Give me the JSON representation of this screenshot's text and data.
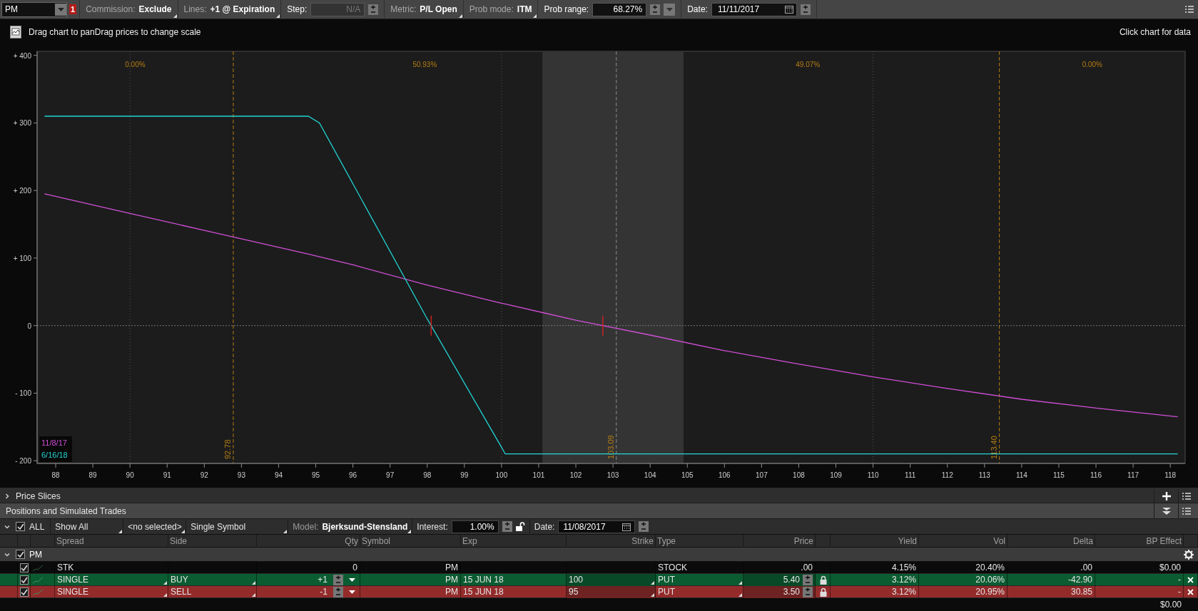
{
  "toolbar": {
    "symbol": "PM",
    "alert_badge": "1",
    "items": [
      {
        "kind": "setting",
        "label": "Commission:",
        "value": "Exclude"
      },
      {
        "kind": "setting",
        "label": "Lines:",
        "value": "+1 @ Expiration"
      },
      {
        "kind": "field",
        "label": "Step:",
        "value": "N/A",
        "disabled": true,
        "dropdown": false
      },
      {
        "kind": "setting",
        "label": "Metric:",
        "value": "P/L Open"
      },
      {
        "kind": "setting",
        "label": "Prob mode:",
        "value": "ITM"
      },
      {
        "kind": "field",
        "label": "Prob range:",
        "value": "68.27%",
        "disabled": false,
        "dropdown": true
      },
      {
        "kind": "date",
        "label": "Date:",
        "value": "11/11/2017"
      }
    ]
  },
  "chart_header": {
    "hint": "Drag chart to panDrag prices to change scale",
    "right_hint": "Click chart for data"
  },
  "chart": {
    "chart_data": {
      "type": "line",
      "x": [
        87.7,
        90,
        92,
        94,
        94.8,
        95.1,
        96,
        98,
        100,
        100.1,
        102,
        104,
        106,
        108,
        110,
        112,
        114,
        116,
        118.2
      ],
      "series": [
        {
          "name": "11/8/17",
          "color": "#d24fd8",
          "values": [
            195,
            166,
            141,
            116,
            106,
            102,
            90,
            60,
            33,
            32,
            8,
            -14,
            -37,
            -57,
            -76,
            -93,
            -109,
            -122,
            -135
          ]
        },
        {
          "name": "6/16/18",
          "color": "#22d4d4",
          "values": [
            310,
            310,
            310,
            310,
            310,
            300,
            210,
            10,
            -180,
            -190,
            -190,
            -190,
            -190,
            -190,
            -190,
            -190,
            -190,
            -190,
            -190
          ]
        }
      ],
      "xlim": [
        87.5,
        118.4
      ],
      "ylim": [
        -204,
        406
      ],
      "xticks": [
        88,
        89,
        90,
        91,
        92,
        93,
        94,
        95,
        96,
        97,
        98,
        99,
        100,
        101,
        102,
        103,
        104,
        105,
        106,
        107,
        108,
        109,
        110,
        111,
        112,
        113,
        114,
        115,
        116,
        117,
        118
      ],
      "yticks": [
        {
          "value": 400,
          "label": "+ 400"
        },
        {
          "value": 300,
          "label": "+ 300"
        },
        {
          "value": 200,
          "label": "+ 200"
        },
        {
          "value": 100,
          "label": "+ 100"
        },
        {
          "value": 0,
          "label": "0"
        },
        {
          "value": -100,
          "label": "- 100"
        },
        {
          "value": -200,
          "label": "- 200"
        }
      ],
      "grid": true,
      "bands": [
        {
          "axis": "x",
          "from": 101.1,
          "to": 104.9
        }
      ],
      "ref_lines": [
        {
          "axis": "x",
          "value": 92.78,
          "label": "92.78",
          "color": "#b57d14"
        },
        {
          "axis": "x",
          "value": 103.09,
          "label": "103.09",
          "color": "#8a8a8a"
        },
        {
          "axis": "x",
          "value": 113.4,
          "label": "113.40",
          "color": "#b57d14"
        },
        {
          "axis": "y",
          "value": 0,
          "color": "#777777"
        }
      ],
      "annotations": [
        "0.00%",
        "50.93%",
        "49.07%",
        "0.00%"
      ]
    }
  },
  "price_slices": {
    "title": "Price Slices",
    "expanded": false
  },
  "positions": {
    "title": "Positions and Simulated Trades",
    "filter": {
      "all_label": "ALL",
      "all_checked": true,
      "show": "Show All",
      "selection": "<no selected>",
      "mode": "Single Symbol",
      "model_label": "Model:",
      "model": "Bjerksund-Stensland",
      "interest_label": "Interest:",
      "interest": "1.00%",
      "interest_locked": false,
      "date_label": "Date:",
      "date": "11/08/2017"
    },
    "columns": [
      "Spread",
      "Side",
      "Qty",
      "Symbol",
      "Exp",
      "Strike",
      "Type",
      "Price",
      "Yield",
      "Vol",
      "Delta",
      "BP Effect"
    ],
    "groups": [
      {
        "symbol": "PM",
        "checked": true,
        "expanded": true,
        "rows": [
          {
            "kind": "stock",
            "checked": true,
            "spread": "STK",
            "qty": "0",
            "symbol": "PM",
            "type": "STOCK",
            "price": ".00",
            "yield": "4.15%",
            "vol": "20.40%",
            "delta": ".00",
            "bp_effect": "$0.00"
          },
          {
            "kind": "buy",
            "checked": true,
            "spread": "SINGLE",
            "side": "BUY",
            "qty": "+1",
            "symbol": "PM",
            "exp": "15 JUN 18",
            "strike": "100",
            "type": "PUT",
            "price": "5.40",
            "locked": true,
            "yield": "3.12%",
            "vol": "20.06%",
            "delta": "-42.90",
            "bp_effect": "-"
          },
          {
            "kind": "sell",
            "checked": true,
            "spread": "SINGLE",
            "side": "SELL",
            "qty": "-1",
            "symbol": "PM",
            "exp": "15 JUN 18",
            "strike": "95",
            "type": "PUT",
            "price": "3.50",
            "locked": true,
            "yield": "3.12%",
            "vol": "20.95%",
            "delta": "30.85",
            "bp_effect": "-"
          }
        ]
      }
    ],
    "total_bp_effect": "$0.00"
  }
}
